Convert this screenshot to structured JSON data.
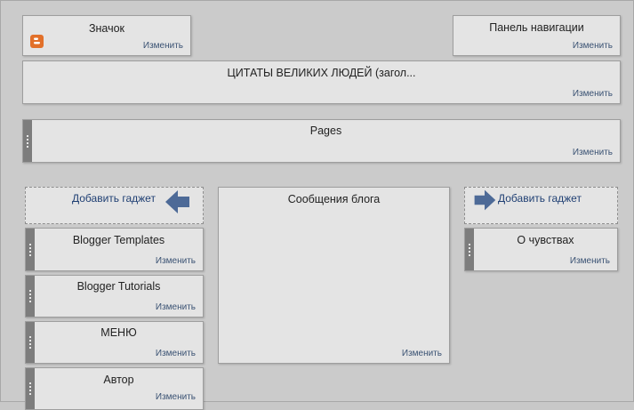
{
  "favicon_gadget": {
    "title": "Значок",
    "edit": "Изменить",
    "icon": "blogger-icon"
  },
  "navbar_gadget": {
    "title": "Панель навигации",
    "edit": "Изменить"
  },
  "header_gadget": {
    "title": "ЦИТАТЫ ВЕЛИКИХ ЛЮДЕЙ (загол...",
    "edit": "Изменить"
  },
  "pages_gadget": {
    "title": "Pages",
    "edit": "Изменить"
  },
  "left_column": {
    "add_gadget": "Добавить гаджет",
    "gadgets": [
      {
        "title": "Blogger Templates",
        "edit": "Изменить"
      },
      {
        "title": "Blogger Tutorials",
        "edit": "Изменить"
      },
      {
        "title": "МЕНЮ",
        "edit": "Изменить"
      },
      {
        "title": "Автор",
        "edit": "Изменить"
      }
    ]
  },
  "main_column": {
    "title": "Сообщения блога",
    "edit": "Изменить"
  },
  "right_column": {
    "add_gadget": "Добавить гаджет",
    "gadgets": [
      {
        "title": "О чувствах",
        "edit": "Изменить"
      }
    ]
  },
  "colors": {
    "accent_arrow": "#4d6a97",
    "link": "#1f3f73",
    "handle": "#7d7d7d",
    "icon": "#e2702a"
  }
}
